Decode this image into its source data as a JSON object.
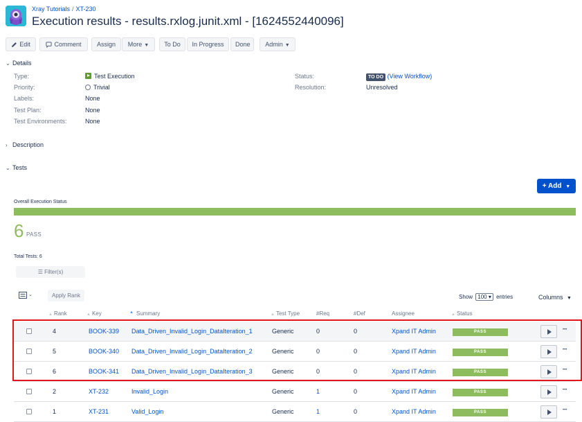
{
  "header": {
    "breadcrumb_project": "Xray Tutorials",
    "breadcrumb_separator": "/",
    "breadcrumb_issue": "XT-230",
    "title": "Execution results - results.rxlog.junit.xml - [1624552440096]"
  },
  "toolbar": {
    "edit": "Edit",
    "comment": "Comment",
    "assign": "Assign",
    "more": "More",
    "todo": "To Do",
    "in_progress": "In Progress",
    "done": "Done",
    "admin": "Admin"
  },
  "details": {
    "heading": "Details",
    "type_label": "Type:",
    "type_value": "Test Execution",
    "priority_label": "Priority:",
    "priority_value": "Trivial",
    "labels_label": "Labels:",
    "labels_value": "None",
    "test_plan_label": "Test Plan:",
    "test_plan_value": "None",
    "test_env_label": "Test Environments:",
    "test_env_value": "None",
    "status_label": "Status:",
    "status_value": "TO DO",
    "view_workflow": "(View Workflow)",
    "resolution_label": "Resolution:",
    "resolution_value": "Unresolved"
  },
  "description": {
    "heading": "Description"
  },
  "tests": {
    "heading": "Tests",
    "add_button": "Add",
    "overall_label": "Overall Execution Status",
    "pass_count": "6",
    "pass_word": "PASS",
    "pass_fraction": 1.0,
    "total_tests": "Total Tests: 6",
    "filter_button": "Filter(s)",
    "apply_rank": "Apply Rank",
    "show_label": "Show",
    "show_value": "100",
    "entries_label": "entries",
    "columns_button": "Columns"
  },
  "table": {
    "headers": {
      "rank": "Rank",
      "key": "Key",
      "summary": "Summary",
      "test_type": "Test Type",
      "req": "#Req",
      "def": "#Def",
      "assignee": "Assignee",
      "status": "Status"
    },
    "rows": [
      {
        "rank": "4",
        "key": "BOOK-339",
        "summary": "Data_Driven_Invalid_Login_DataIteration_1",
        "type": "Generic",
        "req": "0",
        "def": "0",
        "assignee": "Xpand IT Admin",
        "status": "PASS"
      },
      {
        "rank": "5",
        "key": "BOOK-340",
        "summary": "Data_Driven_Invalid_Login_DataIteration_2",
        "type": "Generic",
        "req": "0",
        "def": "0",
        "assignee": "Xpand IT Admin",
        "status": "PASS"
      },
      {
        "rank": "6",
        "key": "BOOK-341",
        "summary": "Data_Driven_Invalid_Login_DataIteration_3",
        "type": "Generic",
        "req": "0",
        "def": "0",
        "assignee": "Xpand IT Admin",
        "status": "PASS"
      },
      {
        "rank": "2",
        "key": "XT-232",
        "summary": "Invalid_Login",
        "type": "Generic",
        "req": "1",
        "def": "0",
        "assignee": "Xpand IT Admin",
        "status": "PASS"
      },
      {
        "rank": "1",
        "key": "XT-231",
        "summary": "Valid_Login",
        "type": "Generic",
        "req": "1",
        "def": "0",
        "assignee": "Xpand IT Admin",
        "status": "PASS"
      }
    ]
  },
  "colors": {
    "pass_green": "#8dbc5e",
    "link_blue": "#0052cc",
    "highlight_red": "#e3151a",
    "primary_button": "#0052cc"
  }
}
